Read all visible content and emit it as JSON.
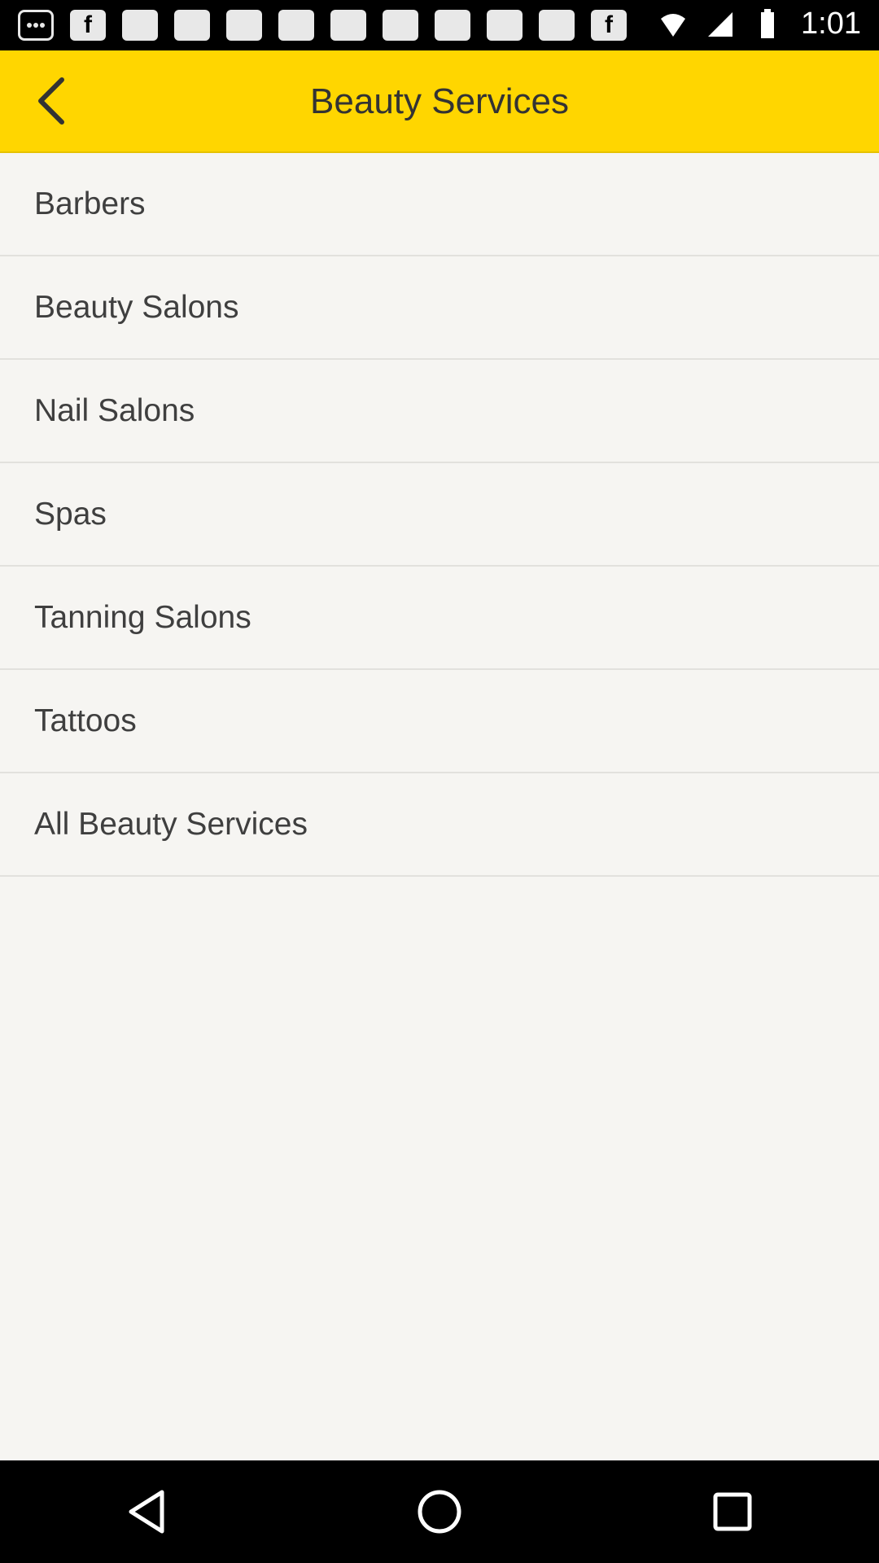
{
  "status_bar": {
    "time": "1:01",
    "notification_icons": [
      "chat-icon",
      "facebook-icon",
      "image-icon",
      "image-icon",
      "image-icon",
      "image-icon",
      "image-icon",
      "image-icon",
      "image-icon",
      "image-icon",
      "image-icon",
      "facebook-icon"
    ],
    "notif_f_label": "f"
  },
  "app_bar": {
    "title": "Beauty Services",
    "background_color": "#ffd600"
  },
  "list": {
    "items": [
      {
        "label": "Barbers"
      },
      {
        "label": "Beauty Salons"
      },
      {
        "label": "Nail Salons"
      },
      {
        "label": "Spas"
      },
      {
        "label": "Tanning Salons"
      },
      {
        "label": "Tattoos"
      },
      {
        "label": "All Beauty Services"
      }
    ]
  },
  "nav_bar": {
    "buttons": [
      "back-triangle-icon",
      "home-circle-icon",
      "recents-square-icon"
    ]
  }
}
